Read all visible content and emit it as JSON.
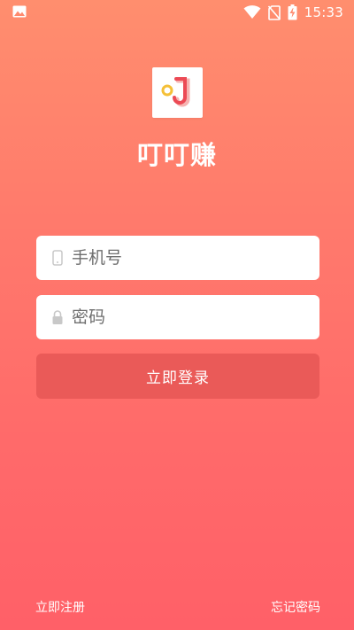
{
  "status_bar": {
    "time": "15:33",
    "icons": [
      "image-notification-icon",
      "wifi-icon",
      "no-sim-icon",
      "battery-charging-icon"
    ]
  },
  "app": {
    "name": "叮叮赚",
    "logo_icon": "app-logo-icon",
    "brand_color": "#ea5a58"
  },
  "login_form": {
    "phone_placeholder": "手机号",
    "phone_value": "",
    "phone_icon": "phone-icon",
    "password_placeholder": "密码",
    "password_value": "",
    "password_icon": "lock-icon",
    "submit_label": "立即登录"
  },
  "footer": {
    "register_label": "立即注册",
    "forgot_label": "忘记密码"
  }
}
